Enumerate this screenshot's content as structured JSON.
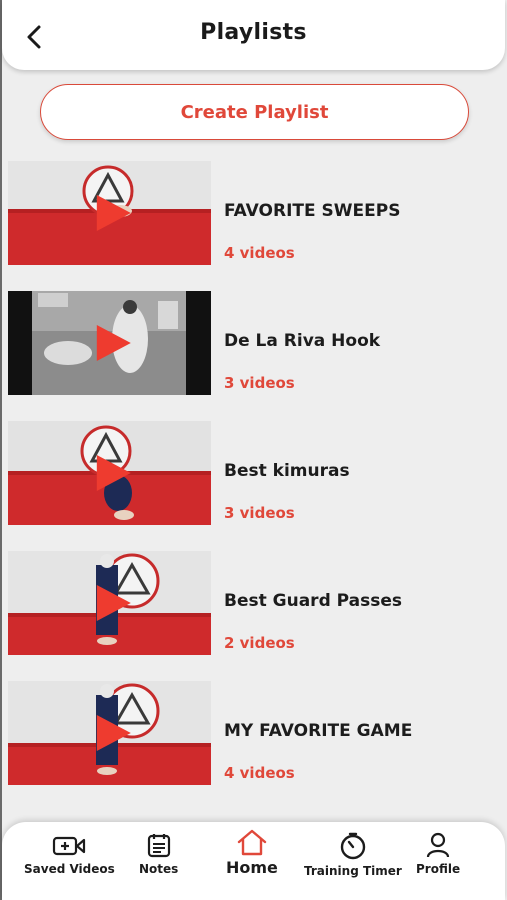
{
  "header": {
    "title": "Playlists"
  },
  "create_button": {
    "label": "Create Playlist"
  },
  "playlists": [
    {
      "title": "FAVORITE SWEEPS",
      "count": "4 videos"
    },
    {
      "title": "De La Riva Hook",
      "count": "3 videos"
    },
    {
      "title": "Best kimuras",
      "count": "3 videos"
    },
    {
      "title": "Best Guard Passes",
      "count": "2 videos"
    },
    {
      "title": "MY FAVORITE GAME",
      "count": "4 videos"
    }
  ],
  "bottom_nav": {
    "items": [
      {
        "label": "Saved Videos",
        "icon": "video-plus-icon"
      },
      {
        "label": "Notes",
        "icon": "notes-icon"
      },
      {
        "label": "Home",
        "icon": "home-icon",
        "active": true
      },
      {
        "label": "Training Timer",
        "icon": "stopwatch-icon"
      },
      {
        "label": "Profile",
        "icon": "user-icon"
      }
    ]
  },
  "colors": {
    "accent": "#e0483a",
    "background": "#eeeeee",
    "mat_red": "#c9282a"
  }
}
